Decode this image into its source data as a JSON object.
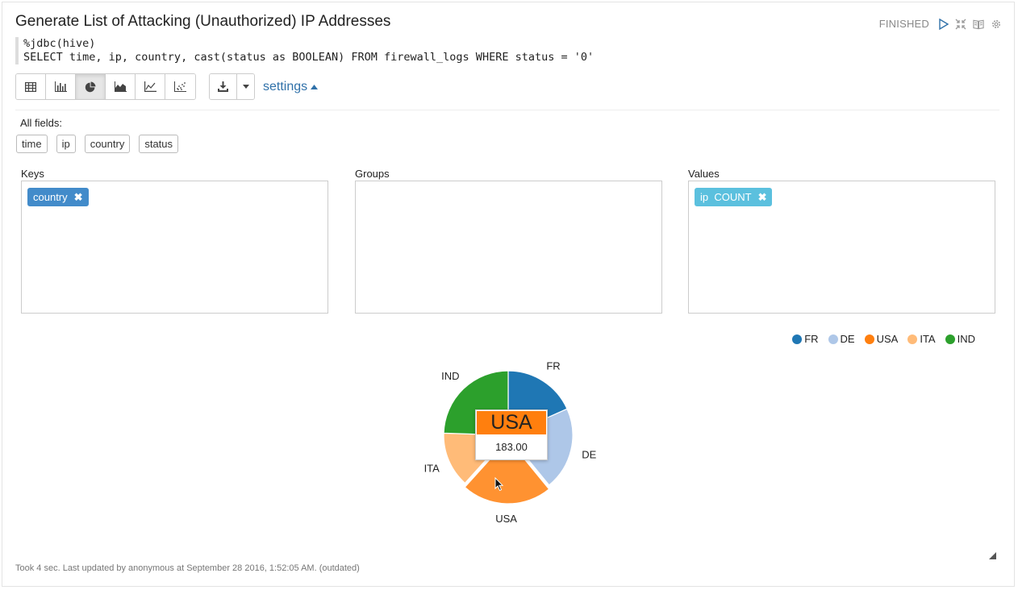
{
  "paragraph": {
    "title": "Generate List of Attacking (Unauthorized) IP Addresses",
    "status": "FINISHED",
    "controls": [
      "run-icon",
      "collapse-icon",
      "book-icon",
      "gear-icon"
    ]
  },
  "code": {
    "line1": "%jdbc(hive)",
    "line2": "SELECT time, ip, country, cast(status as BOOLEAN) FROM firewall_logs WHERE status = '0'"
  },
  "toolbar": {
    "views": [
      "table-icon",
      "bar-chart-icon",
      "pie-chart-icon",
      "area-chart-icon",
      "line-chart-icon",
      "scatter-chart-icon"
    ],
    "active_view": "pie-chart-icon",
    "settings_label": "settings"
  },
  "fields": {
    "label": "All fields:",
    "items": [
      "time",
      "ip",
      "country",
      "status"
    ]
  },
  "keys": {
    "label": "Keys",
    "chip": "country",
    "chip_color": "#428bca"
  },
  "groups": {
    "label": "Groups"
  },
  "values": {
    "label": "Values",
    "chip": "ip  COUNT",
    "chip_color": "#5bc0de"
  },
  "chart_data": {
    "type": "pie",
    "categories": [
      "FR",
      "DE",
      "USA",
      "ITA",
      "IND"
    ],
    "values": [
      148,
      168,
      183,
      112,
      198
    ],
    "colors": [
      "#1f77b4",
      "#aec7e8",
      "#ff7f0e",
      "#ffbb78",
      "#2ca02c"
    ],
    "legend_position": "top-right",
    "highlighted": "USA"
  },
  "tooltip": {
    "label": "USA",
    "value": "183.00"
  },
  "footer": "Took 4 sec. Last updated by anonymous at September 28 2016, 1:52:05 AM. (outdated)"
}
